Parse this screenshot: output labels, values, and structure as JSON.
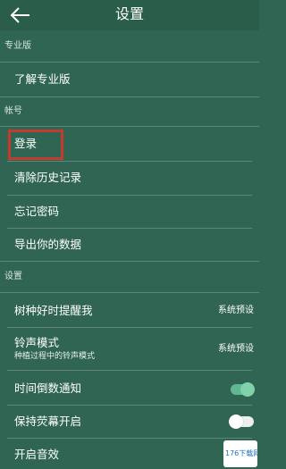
{
  "app": {
    "title": "设置"
  },
  "sections": {
    "pro": "专业版",
    "account": "帐号",
    "settings": "设置"
  },
  "items": {
    "learn_pro": "了解专业版",
    "login": "登录",
    "clear_history": "清除历史记录",
    "forgot_password": "忘记密码",
    "export_data": "导出你的数据",
    "tree_reminder": {
      "label": "树种好时提醒我",
      "value": "系统预设"
    },
    "ringtone": {
      "label": "铃声模式",
      "subtitle": "种植过程中的铃声模式",
      "value": "系统预设"
    },
    "countdown_notify": {
      "label": "时间倒数通知",
      "toggle": "on"
    },
    "keep_screen_on": {
      "label": "保持荧幕开启",
      "toggle": "off"
    },
    "sound_effects": {
      "label": "开启音效"
    }
  },
  "watermark": {
    "text": "176下载网"
  },
  "colors": {
    "background": "#2f6552",
    "highlight_box": "#c43b2f",
    "toggle_on": "#5fb891"
  },
  "icons": {
    "back": "arrow-left-icon"
  }
}
